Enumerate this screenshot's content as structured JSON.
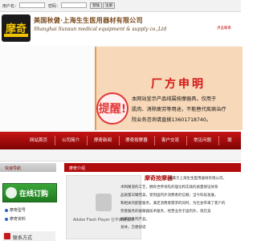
{
  "login": {
    "username_label": "用户名：",
    "password_label": "密码：",
    "login_button": "登陆",
    "register_button": "注册"
  },
  "header": {
    "logo_text": "摩奇",
    "company_cn": "美国秋健·上海生生医用器材有限公司",
    "company_en": "Shanghai Sunsun medical equipment & supply co.,Ltd",
    "tel_link": "点击联系"
  },
  "notice": {
    "stamp": "提醒!",
    "title": "厂方申明",
    "lines": [
      "本网站宣示产品纯属按摩器具，仅用于",
      "肌肉、消除疲劳等用途，不能替代疾病治疗",
      "院业务咨询请直拨13601718740。"
    ]
  },
  "nav": {
    "items": [
      "网站首页",
      "公司简介",
      "摩奇新闻",
      "摩奇按摩器",
      "客户交流",
      "常见问题",
      "联"
    ]
  },
  "sidebar": {
    "quick_title": "快速导航",
    "order_label": "在线订购",
    "links": [
      "摩奇型号",
      "摩奇资料"
    ],
    "contact_label": "联系方式"
  },
  "content": {
    "section_title": "摩奇介绍",
    "flash_text": "Adobe Flash Player 已不再受支持",
    "intro_title": "摩奇按摩器",
    "intro_lines": [
      "隶属于上海生生医用器材有限公司，",
      "术和精湛的工艺，拥有世界领先的理论和实践的质量保证体系",
      "品质量日臻完美，受到国内外消费者的信赖；当今科技发展，",
      "和相关的配套服务，满足消费者需求的同时，为社会带来了客户的",
      "完善服务的按摩器技术服务，经营业务于国内外。现在美",
      "按摩器系列产品，",
      "身体，方便舒适"
    ]
  },
  "colors": {
    "nav_red": "#b10d0d",
    "notice_bg": "#f7d8b8",
    "order_green": "#2a8f2a",
    "logo_gold": "#f2c200"
  }
}
